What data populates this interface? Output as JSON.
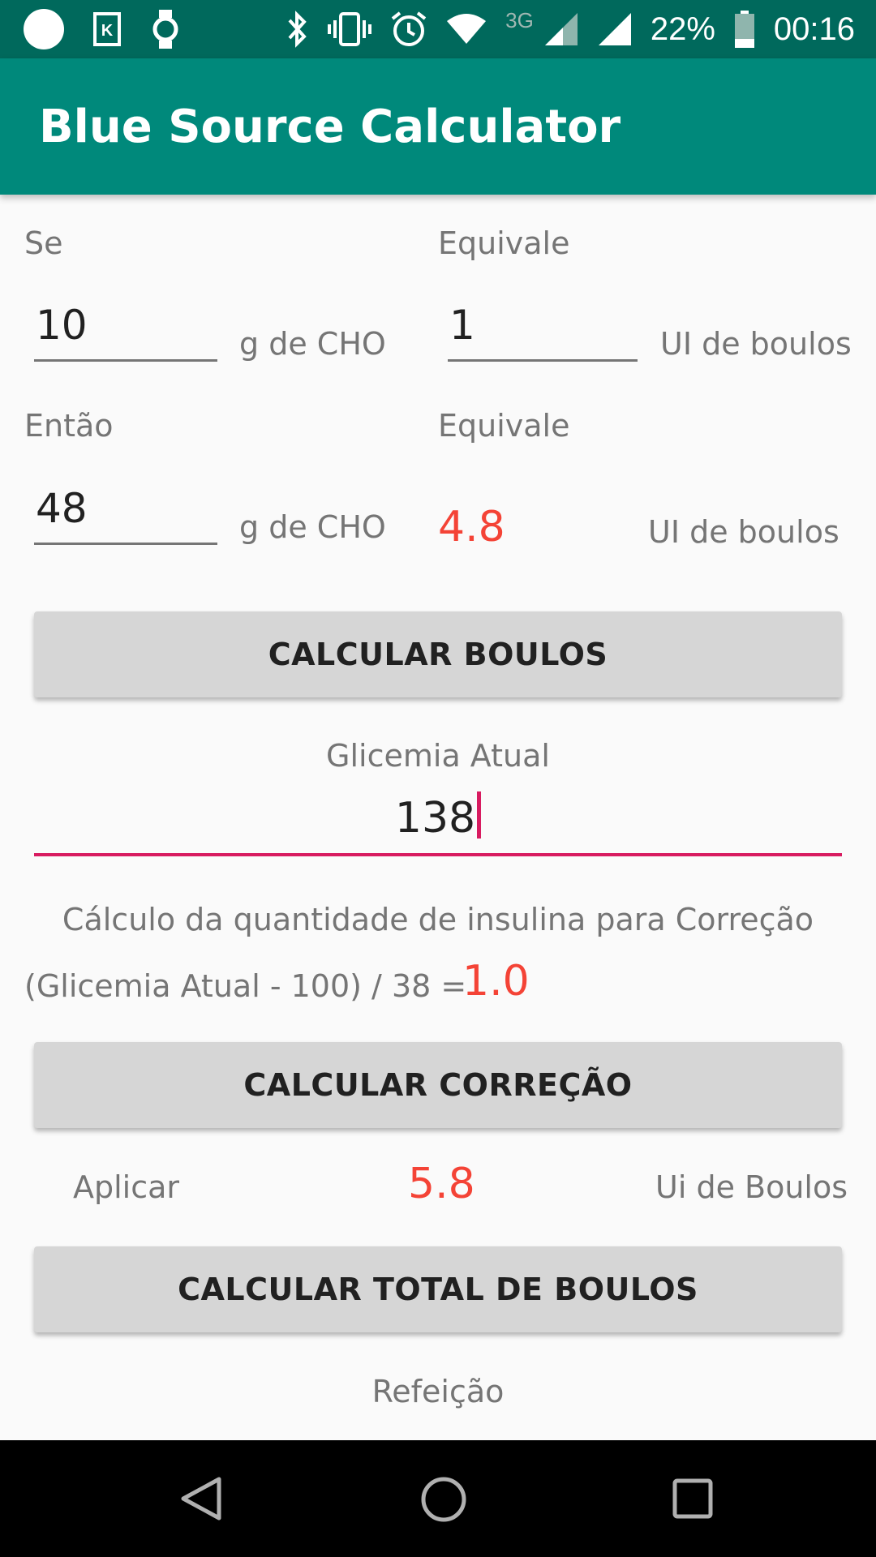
{
  "status_bar": {
    "battery": "22%",
    "network": "3G",
    "time": "00:16",
    "icons": [
      "circle-icon",
      "k-app-icon",
      "watch-icon",
      "bluetooth-icon",
      "vibrate-icon",
      "alarm-icon",
      "wifi-icon",
      "signal-icon",
      "signal-icon-2",
      "battery-icon"
    ]
  },
  "app_bar": {
    "title": "Blue Source Calculator"
  },
  "ratio": {
    "se_label": "Se",
    "equivale_label": "Equivale",
    "carbs_value": "10",
    "carbs_unit": "g de CHO",
    "insulin_value": "1",
    "insulin_unit": "UI de boulos"
  },
  "meal": {
    "entao_label": "Então",
    "equivale_label": "Equivale",
    "carbs_value": "48",
    "carbs_unit": "g de CHO",
    "result": "4.8",
    "result_unit": "UI de boulos"
  },
  "buttons": {
    "calc_bolus": "CALCULAR BOULOS",
    "calc_correction": "CALCULAR CORREÇÃO",
    "calc_total": "CALCULAR TOTAL DE BOULOS"
  },
  "glycemia": {
    "label": "Glicemia Atual",
    "value": "138"
  },
  "correction": {
    "title": "Cálculo da quantidade de insulina para Correção",
    "formula": "(Glicemia Atual - 100) / 38 =",
    "result": "1.0"
  },
  "total": {
    "apply_label": "Aplicar",
    "value": "5.8",
    "unit": "Ui de Boulos"
  },
  "footer": {
    "meal_label": "Refeição"
  },
  "colors": {
    "status_bar": "#00695c",
    "app_bar": "#00897b",
    "accent": "#d81b60",
    "result": "#f44336"
  }
}
